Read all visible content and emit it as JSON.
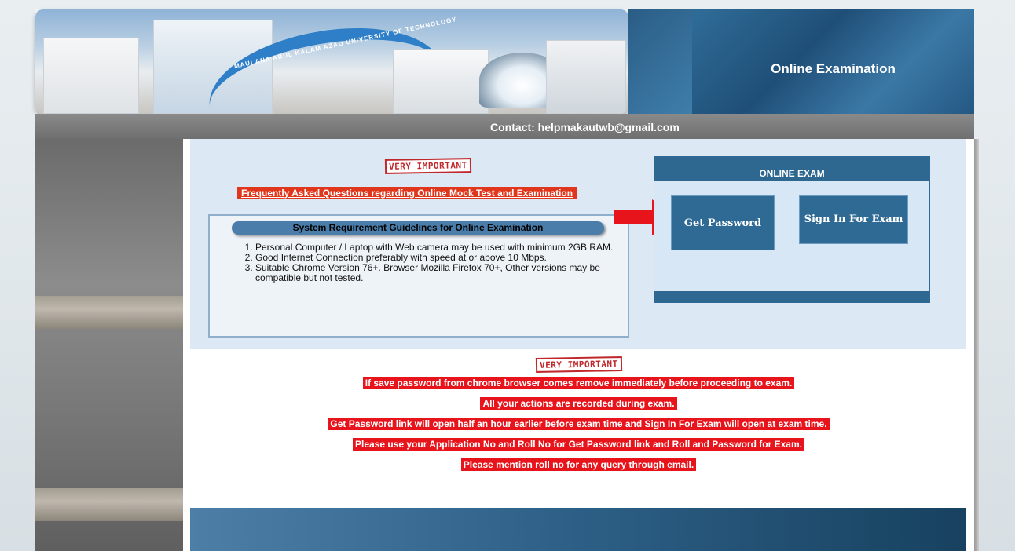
{
  "header": {
    "banner_arch_text": "MAULANA ABUL KALAM AZAD UNIVERSITY OF TECHNOLOGY",
    "title": "Online Examination",
    "contact": "Contact: helpmakautwb@gmail.com"
  },
  "faq": {
    "badge": "VERY IMPORTANT",
    "link_text": "Frequently Asked Questions regarding Online Mock Test and Examination"
  },
  "system_requirements": {
    "title": "System Requirement Guidelines for Online Examination",
    "items": [
      "Personal Computer / Laptop with Web camera may be used with minimum 2GB RAM.",
      "Good Internet Connection preferably with speed at or above 10 Mbps.",
      "Suitable Chrome Version 76+. Browser Mozilla Firefox 70+, Other versions may be compatible but not tested."
    ]
  },
  "online_exam": {
    "heading": "ONLINE EXAM",
    "get_password_label": "Get Password",
    "sign_in_label": "Sign In For Exam"
  },
  "notices": {
    "badge": "VERY IMPORTANT",
    "lines": [
      "If save password from chrome browser comes remove immediately before proceeding to exam.",
      "All your actions are recorded during exam.",
      "Get Password link will open half an hour earlier before exam time and Sign In For Exam will open at exam time.",
      "Please use your Application No and Roll No for Get Password link and Roll and Password for Exam.",
      "Please mention roll no for any query through email."
    ]
  },
  "colors": {
    "accent_blue": "#2e6891",
    "notice_red": "#e8141b",
    "faq_orange": "#e0361b"
  }
}
